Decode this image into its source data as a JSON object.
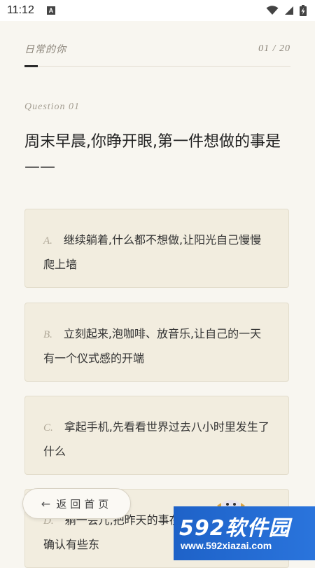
{
  "status_bar": {
    "time": "11:12",
    "notification_icon": "a-icon",
    "wifi_icon": "wifi-icon",
    "signal_icon": "signal-icon",
    "battery_icon": "battery-charging-icon"
  },
  "header": {
    "app_title": "日常的你",
    "progress": "01 / 20"
  },
  "question": {
    "label": "Question 01",
    "text": "周末早晨,你睁开眼,第一件想做的事是——"
  },
  "options": [
    {
      "letter": "A.",
      "text": "继续躺着,什么都不想做,让阳光自己慢慢爬上墙"
    },
    {
      "letter": "B.",
      "text": "立刻起来,泡咖啡、放音乐,让自己的一天有一个仪式感的开端"
    },
    {
      "letter": "C.",
      "text": "拿起手机,先看看世界过去八小时里发生了什么"
    },
    {
      "letter": "D.",
      "text": "躺一会儿,把昨天的事在脑子里复述一遍,确认有些东"
    }
  ],
  "home_button": {
    "arrow": "←",
    "label": "返回首页"
  },
  "watermark": {
    "logo": "592软件园",
    "url": "www.592xiazai.com"
  },
  "colors": {
    "background": "#f8f6f0",
    "option_bg": "#f2eddf",
    "accent": "#2b2b2b",
    "watermark_blue": "#1e62c8"
  }
}
